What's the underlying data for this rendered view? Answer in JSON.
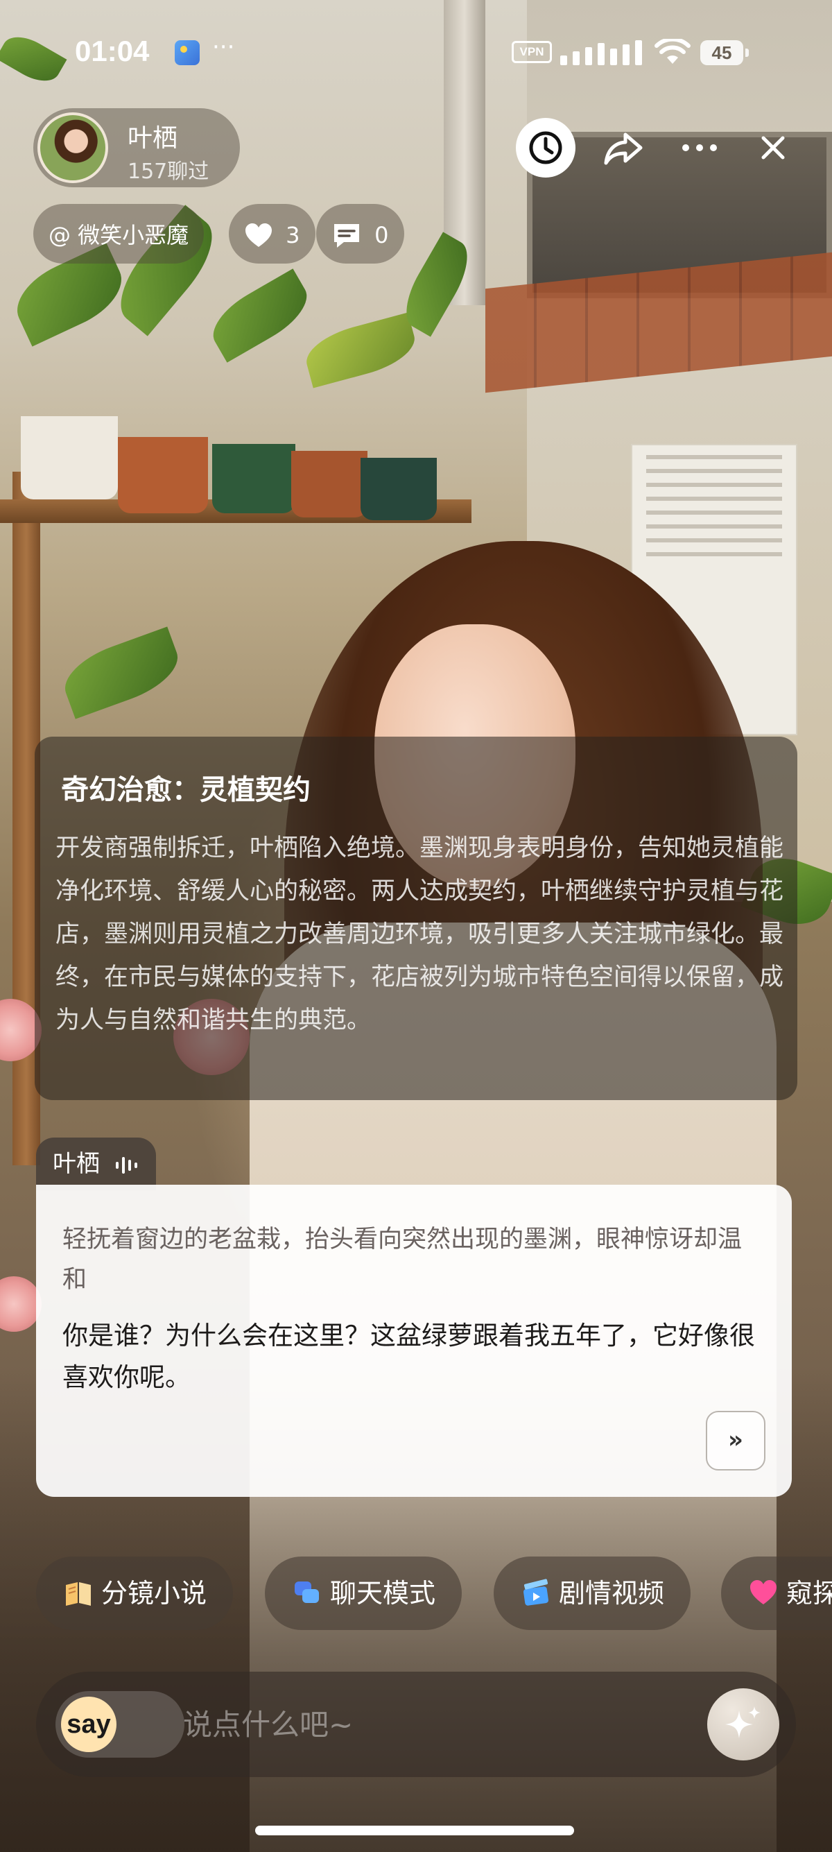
{
  "status_bar": {
    "time": "01:04",
    "dots": "···",
    "vpn": "VPN",
    "battery": "45"
  },
  "header": {
    "character_name": "叶栖",
    "chat_count": "157聊过",
    "author": "@ 微笑小恶魔",
    "likes": "3",
    "comments": "0"
  },
  "story": {
    "title": "奇幻治愈：灵植契约",
    "description": "开发商强制拆迁，叶栖陷入绝境。墨渊现身表明身份，告知她灵植能净化环境、舒缓人心的秘密。两人达成契约，叶栖继续守护灵植与花店，墨渊则用灵植之力改善周边环境，吸引更多人关注城市绿化。最终，在市民与媒体的支持下，花店被列为城市特色空间得以保留，成为人与自然和谐共生的典范。"
  },
  "dialog": {
    "speaker": "叶栖",
    "action": "轻抚着窗边的老盆栽，抬头看向突然出现的墨渊，眼神惊讶却温和",
    "speech": "你是谁？为什么会在这里？这盆绿萝跟着我五年了，它好像很喜欢你呢。",
    "next_label": "»"
  },
  "modes": [
    {
      "label": "分镜小说",
      "icon": "book-icon"
    },
    {
      "label": "聊天模式",
      "icon": "chat-bubbles-icon"
    },
    {
      "label": "剧情视频",
      "icon": "video-clapper-icon"
    },
    {
      "label": "窥探",
      "icon": "heart-icon"
    }
  ],
  "input": {
    "say_label": "say",
    "placeholder": "说点什么吧~"
  },
  "colors": {
    "accent_knob": "#ffe3b0",
    "card_bg": "rgba(40,34,30,0.55)",
    "dialog_bg": "#ffffff"
  }
}
